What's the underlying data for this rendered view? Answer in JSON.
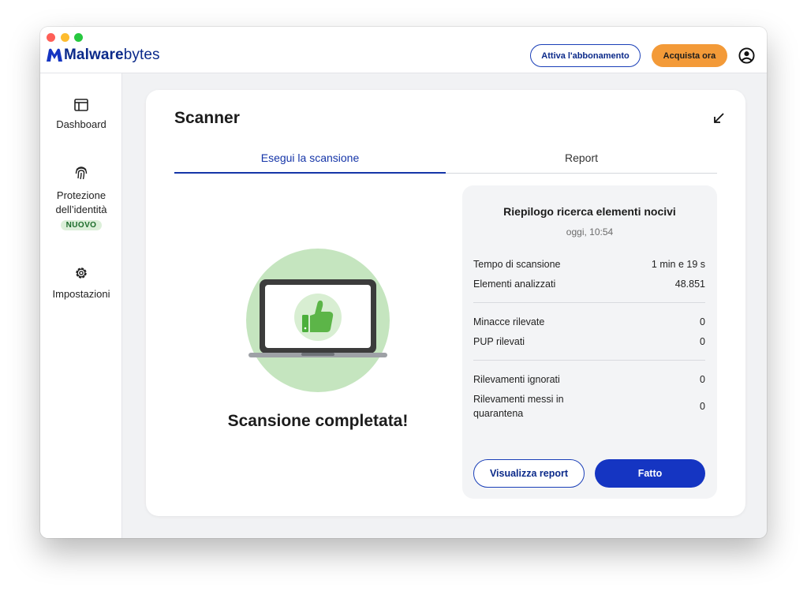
{
  "app": {
    "logo_text_bold": "Malware",
    "logo_text_regular": "bytes",
    "brand_color": "#0b2a8a"
  },
  "header": {
    "subscribe_label": "Attiva l'abbonamento",
    "buy_label": "Acquista ora",
    "account_icon": "account-circle-icon"
  },
  "sidebar": {
    "items": [
      {
        "label": "Dashboard",
        "icon": "dashboard-icon"
      },
      {
        "label": "Protezione dell’identità",
        "icon": "fingerprint-icon",
        "badge": "NUOVO"
      },
      {
        "label": "Impostazioni",
        "icon": "gear-icon"
      }
    ]
  },
  "scanner": {
    "title": "Scanner",
    "collapse_icon": "arrow-down-left-icon",
    "tabs": [
      {
        "label": "Esegui la scansione",
        "active": true
      },
      {
        "label": "Report",
        "active": false
      }
    ],
    "status_text": "Scansione completata!",
    "illustration": "laptop-thumbs-up-icon"
  },
  "summary": {
    "title": "Riepilogo ricerca elementi nocivi",
    "timestamp": "oggi, 10:54",
    "groups": [
      [
        {
          "label": "Tempo di scansione",
          "value": "1 min e 19 s"
        },
        {
          "label": "Elementi analizzati",
          "value": "48.851"
        }
      ],
      [
        {
          "label": "Minacce rilevate",
          "value": "0"
        },
        {
          "label": "PUP rilevati",
          "value": "0"
        }
      ],
      [
        {
          "label": "Rilevamenti ignorati",
          "value": "0"
        },
        {
          "label": "Rilevamenti messi in quarantena",
          "value": "0"
        }
      ]
    ],
    "view_report_label": "Visualizza report",
    "done_label": "Fatto"
  },
  "colors": {
    "primary": "#1535c2",
    "accent_orange": "#f39a38",
    "success_green": "#5cb548",
    "badge_bg": "#dcefd9"
  }
}
